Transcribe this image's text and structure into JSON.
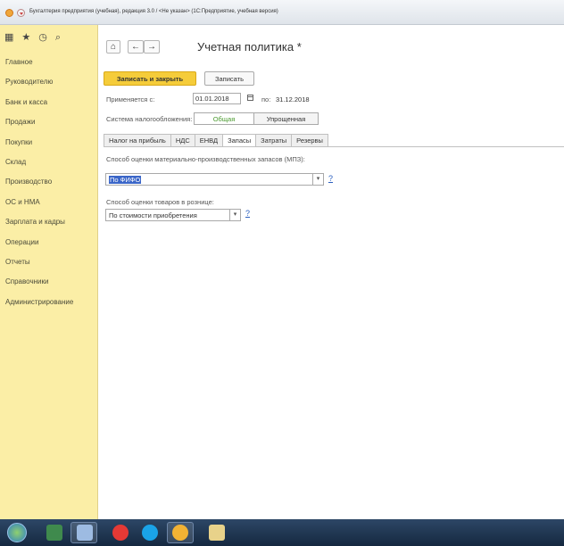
{
  "window": {
    "title": "Бухгалтерия предприятия (учебная), редакция 3.0 / <Не указан> (1С:Предприятие, учебная версия)",
    "app_icon": "1c-logo-icon",
    "menu_icon": "chevron-down-icon"
  },
  "sidebar": {
    "tools": [
      {
        "name": "apps-grid-icon",
        "glyph": "▦"
      },
      {
        "name": "star-icon",
        "glyph": "★"
      },
      {
        "name": "history-icon",
        "glyph": "◷"
      },
      {
        "name": "search-icon",
        "glyph": "⌕"
      }
    ],
    "items": [
      "Главное",
      "Руководителю",
      "Банк и касса",
      "Продажи",
      "Покупки",
      "Склад",
      "Производство",
      "ОС и НМА",
      "Зарплата и кадры",
      "Операции",
      "Отчеты",
      "Справочники",
      "Администрирование"
    ]
  },
  "form": {
    "home_glyph": "⌂",
    "back_glyph": "←",
    "forward_glyph": "→",
    "title": "Учетная политика *",
    "save_close_label": "Записать и закрыть",
    "save_label": "Записать",
    "applies_from_label": "Применяется с:",
    "applies_from_value": "01.01.2018",
    "to_label": "по:",
    "to_value": "31.12.2018",
    "tax_system_label": "Система налогообложения:",
    "tax_system_options": [
      "Общая",
      "Упрощенная"
    ],
    "tax_system_selected": "Общая",
    "tabs": [
      "Налог на прибыль",
      "НДС",
      "ЕНВД",
      "Запасы",
      "Затраты",
      "Резервы"
    ],
    "active_tab": "Запасы",
    "mpz_label": "Способ оценки материально-производственных запасов (МПЗ):",
    "mpz_value": "По ФИФО",
    "retail_label": "Способ оценки товаров в рознице:",
    "retail_value": "По стоимости приобретения",
    "help_glyph": "?",
    "dropdown_glyph": "▾"
  },
  "taskbar": {
    "items": [
      "windows-start-icon",
      "app-icon",
      "word-icon",
      "yandex-browser-icon",
      "skype-icon",
      "1c-icon",
      "file-manager-icon"
    ]
  },
  "colors": {
    "sidebar_bg": "#fbeea6",
    "primary_button": "#f5cc3a",
    "selection": "#3b66c8",
    "active_option": "#4a9a2f",
    "help_link": "#2b5fbf"
  }
}
